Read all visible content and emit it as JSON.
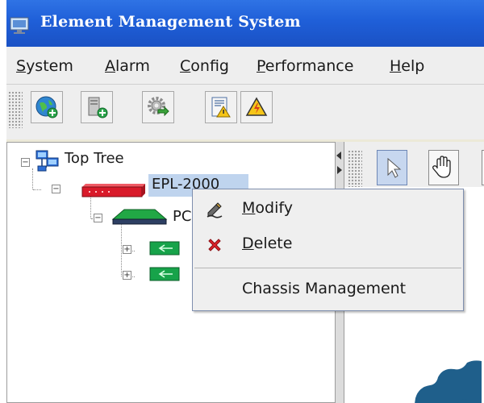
{
  "window": {
    "title": "Element Management System"
  },
  "menubar": {
    "items": [
      {
        "label": "System",
        "mnemonic": "S",
        "rest": "ystem"
      },
      {
        "label": "Alarm",
        "mnemonic": "A",
        "rest": "larm"
      },
      {
        "label": "Config",
        "mnemonic": "C",
        "rest": "onfig"
      },
      {
        "label": "Performance",
        "mnemonic": "P",
        "rest": "erformance"
      },
      {
        "label": "Help",
        "mnemonic": "H",
        "rest": "elp"
      }
    ]
  },
  "toolbar": {
    "buttons": [
      "globe-add-icon",
      "server-add-icon",
      "gear-arrow-icon",
      "alarm-report-icon",
      "warning-icon"
    ]
  },
  "tree": {
    "root": {
      "label": "Top Tree",
      "expanded": true
    },
    "node1": {
      "label": "EPL-2000",
      "visible_label": "EPL-2000",
      "expanded": true,
      "selected": true
    },
    "node2": {
      "label": "PC",
      "expanded": true
    },
    "node3": {
      "label": "",
      "expanded": false
    },
    "node4": {
      "label": "",
      "expanded": false
    }
  },
  "context_menu": {
    "items": [
      {
        "label": "Modify",
        "mnemonic": "M",
        "rest": "odify",
        "icon": "pencil-icon"
      },
      {
        "label": "Delete",
        "mnemonic": "D",
        "rest": "elete",
        "icon": "red-x-icon"
      },
      {
        "label": "Chassis Management",
        "icon": ""
      }
    ]
  },
  "right_toolbar": {
    "buttons": [
      "pointer-arrow-icon",
      "hand-pan-icon"
    ]
  },
  "colors": {
    "titlebar": "#1f5fd8",
    "selection": "#bfd4ee",
    "device_red": "#d91a2a",
    "card_green": "#17a34a"
  }
}
